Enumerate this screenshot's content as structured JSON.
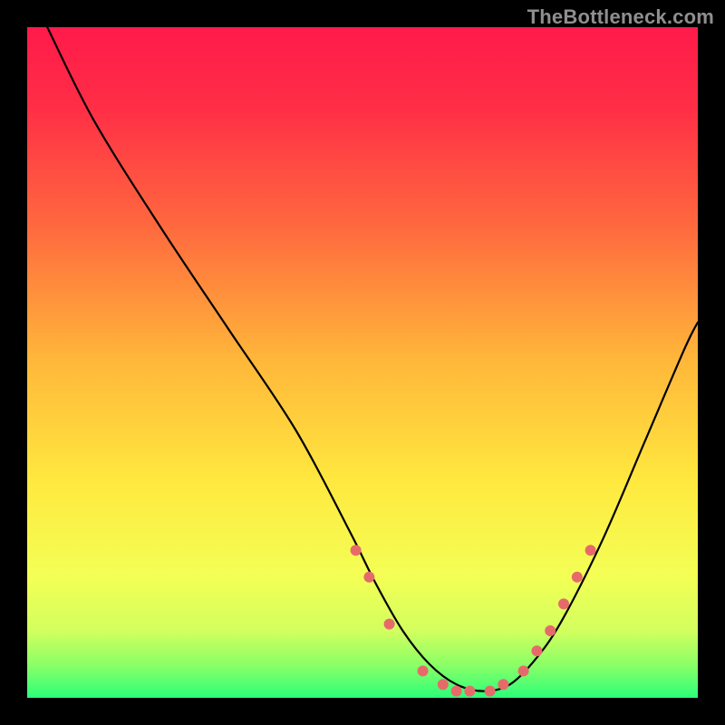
{
  "watermark": "TheBottleneck.com",
  "chart_data": {
    "type": "line",
    "title": "",
    "xlabel": "",
    "ylabel": "",
    "xlim": [
      0,
      100
    ],
    "ylim": [
      0,
      100
    ],
    "grid": false,
    "legend": false,
    "background_gradient": {
      "top": "#ff1a4a",
      "mid_upper": "#ffcf3a",
      "mid_lower": "#f7ff66",
      "bottom": "#2bff7a"
    },
    "series": [
      {
        "name": "bottleneck-curve",
        "x": [
          3,
          10,
          20,
          30,
          40,
          48,
          52,
          56,
          60,
          64,
          68,
          72,
          76,
          80,
          86,
          92,
          98,
          100
        ],
        "y": [
          100,
          86,
          70,
          55,
          40,
          25,
          17,
          10,
          5,
          2,
          1,
          2,
          6,
          12,
          24,
          38,
          52,
          56
        ]
      }
    ],
    "markers": {
      "name": "highlight-points",
      "color": "#e76a6a",
      "x": [
        49,
        51,
        54,
        59,
        62,
        64,
        66,
        69,
        71,
        74,
        76,
        78,
        80,
        82,
        84
      ],
      "y": [
        22,
        18,
        11,
        4,
        2,
        1,
        1,
        1,
        2,
        4,
        7,
        10,
        14,
        18,
        22
      ]
    }
  }
}
